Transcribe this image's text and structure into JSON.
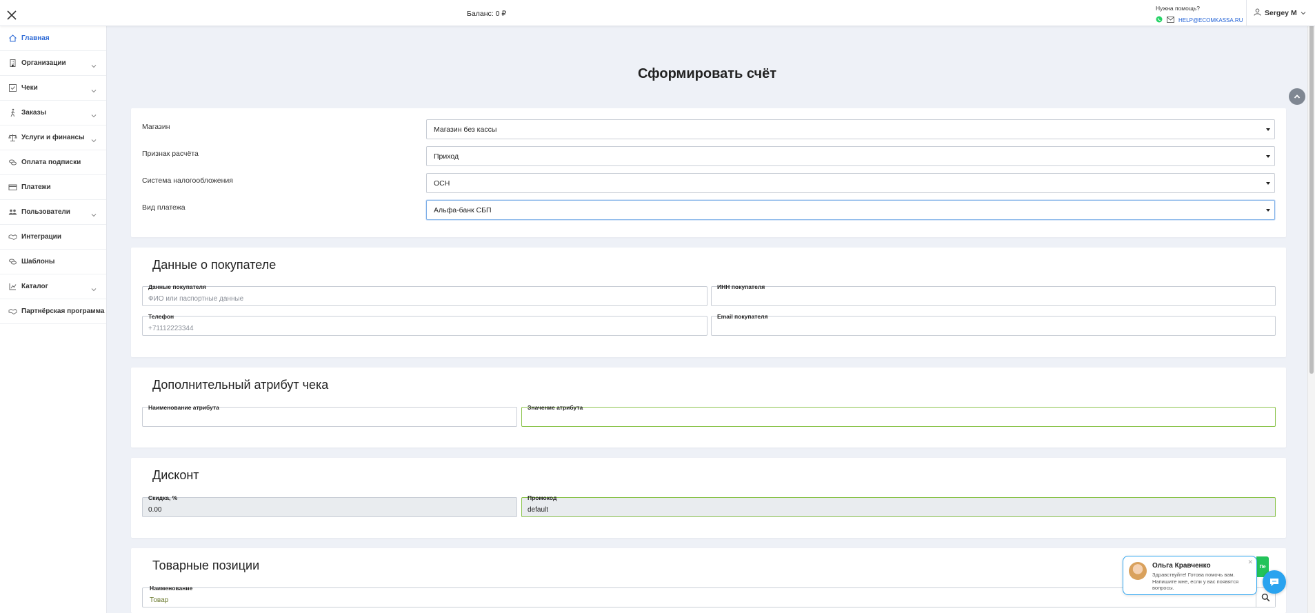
{
  "topbar": {
    "balance": "Баланс: 0 ₽",
    "help_title": "Нужна помощь?",
    "help_email": "HELP@ECOMKASSA.RU",
    "user_name": "Sergey M"
  },
  "sidebar": {
    "items": [
      {
        "label": "Главная",
        "icon": "home-icon",
        "active": true,
        "expandable": false
      },
      {
        "label": "Организации",
        "icon": "building-icon",
        "active": false,
        "expandable": true
      },
      {
        "label": "Чеки",
        "icon": "checkbox-icon",
        "active": false,
        "expandable": true
      },
      {
        "label": "Заказы",
        "icon": "walking-person-icon",
        "active": false,
        "expandable": true
      },
      {
        "label": "Услуги и финансы",
        "icon": "scales-icon",
        "active": false,
        "expandable": true
      },
      {
        "label": "Оплата подписки",
        "icon": "coins-icon",
        "active": false,
        "expandable": false
      },
      {
        "label": "Платежи",
        "icon": "credit-card-icon",
        "active": false,
        "expandable": false
      },
      {
        "label": "Пользователи",
        "icon": "users-icon",
        "active": false,
        "expandable": true
      },
      {
        "label": "Интеграции",
        "icon": "handshake-icon",
        "active": false,
        "expandable": false
      },
      {
        "label": "Шаблоны",
        "icon": "coins-icon",
        "active": false,
        "expandable": false
      },
      {
        "label": "Каталог",
        "icon": "catalog-icon",
        "active": false,
        "expandable": true
      },
      {
        "label": "Партнёрская программа",
        "icon": "handshake-icon",
        "active": false,
        "expandable": false
      }
    ]
  },
  "page": {
    "title": "Сформировать счёт"
  },
  "settings": {
    "shop_label": "Магазин",
    "shop_value": "Магазин без кассы",
    "calc_label": "Признак расчёта",
    "calc_value": "Приход",
    "tax_label": "Система налогообложения",
    "tax_value": "ОСН",
    "pay_label": "Вид платежа",
    "pay_value": "Альфа-банк СБП"
  },
  "buyer": {
    "heading": "Данные о покупателе",
    "name_label": "Данные покупателя",
    "name_placeholder": "ФИО или паспортные данные",
    "inn_label": "ИНН покупателя",
    "phone_label": "Телефон",
    "phone_placeholder": "+71112223344",
    "email_label": "Email покупателя"
  },
  "attribute": {
    "heading": "Дополнительный атрибут чека",
    "name_label": "Наименование атрибута",
    "value_label": "Значение атрибута"
  },
  "discount": {
    "heading": "Дисконт",
    "percent_label": "Скидка, %",
    "percent_value": "0.00",
    "promo_label": "Промокод",
    "promo_value": "default"
  },
  "products": {
    "heading": "Товарные позиции",
    "name_label": "Наименование",
    "name_value": "Товар"
  },
  "chat": {
    "agent_name": "Ольга Кравченко",
    "message": "Здравствуйте! Готова помочь вам. Напишите мне, если у вас появятся вопросы.",
    "green_tab": "Пе"
  },
  "colors": {
    "accent_blue": "#2f6bd6",
    "valid_green": "#8ac34a",
    "chat_blue": "#2aa3ef",
    "whatsapp_green": "#25d366"
  }
}
